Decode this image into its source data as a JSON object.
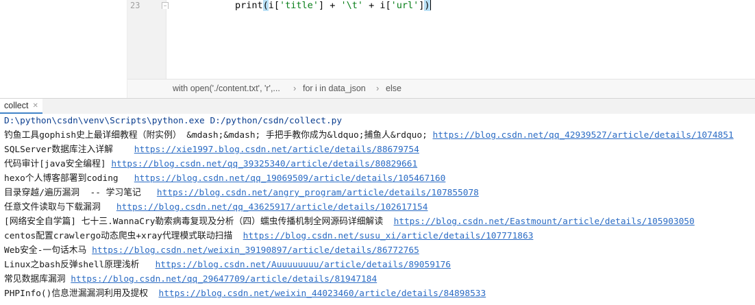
{
  "editor": {
    "line_number": "23",
    "code": {
      "indent": "        ",
      "fn": "print",
      "open": "(",
      "var1": "i[",
      "key_title": "'title'",
      "mid1": "] + ",
      "tab": "'\\t'",
      "mid2": " + i[",
      "key_url": "'url'",
      "end1": "]",
      "close": ")"
    },
    "breadcrumbs": [
      "with open('./content.txt', 'r',...",
      "for i in data_json",
      "else"
    ]
  },
  "run": {
    "tab_label": "collect",
    "command": "D:\\python\\csdn\\venv\\Scripts\\python.exe D:/python/csdn/collect.py",
    "lines": [
      {
        "title": "钓鱼工具gophish史上最详细教程（附实例） &mdash;&mdash; 手把手教你成为&ldquo;捕鱼人&rdquo; ",
        "url": "https://blog.csdn.net/qq_42939527/article/details/1074851"
      },
      {
        "title": "SQLServer数据库注入详解    ",
        "url": "https://xie1997.blog.csdn.net/article/details/88679754"
      },
      {
        "title": "代码审计[java安全编程] ",
        "url": "https://blog.csdn.net/qq_39325340/article/details/80829661"
      },
      {
        "title": "hexo个人博客部署到coding   ",
        "url": "https://blog.csdn.net/qq_19069509/article/details/105467160"
      },
      {
        "title": "目录穿越/遍历漏洞  -- 学习笔记   ",
        "url": "https://blog.csdn.net/angry_program/article/details/107855078"
      },
      {
        "title": "任意文件读取与下载漏洞   ",
        "url": "https://blog.csdn.net/qq_43625917/article/details/102617154"
      },
      {
        "title": "[网络安全自学篇] 七十三.WannaCry勒索病毒复现及分析（四）蠕虫传播机制全网源码详细解读  ",
        "url": "https://blog.csdn.net/Eastmount/article/details/105903050"
      },
      {
        "title": "centos配置crawlergo动态爬虫+xray代理模式联动扫描  ",
        "url": "https://blog.csdn.net/susu_xi/article/details/107771863"
      },
      {
        "title": "Web安全-一句话木马 ",
        "url": "https://blog.csdn.net/weixin_39190897/article/details/86772765"
      },
      {
        "title": "Linux之bash反弹shell原理浅析   ",
        "url": "https://blog.csdn.net/Auuuuuuuu/article/details/89059176"
      },
      {
        "title": "常见数据库漏洞 ",
        "url": "https://blog.csdn.net/qq_29647709/article/details/81947184"
      },
      {
        "title": "PHPInfo()信息泄漏漏洞利用及提权  ",
        "url": "https://blog.csdn.net/weixin_44023460/article/details/84898533"
      }
    ]
  }
}
